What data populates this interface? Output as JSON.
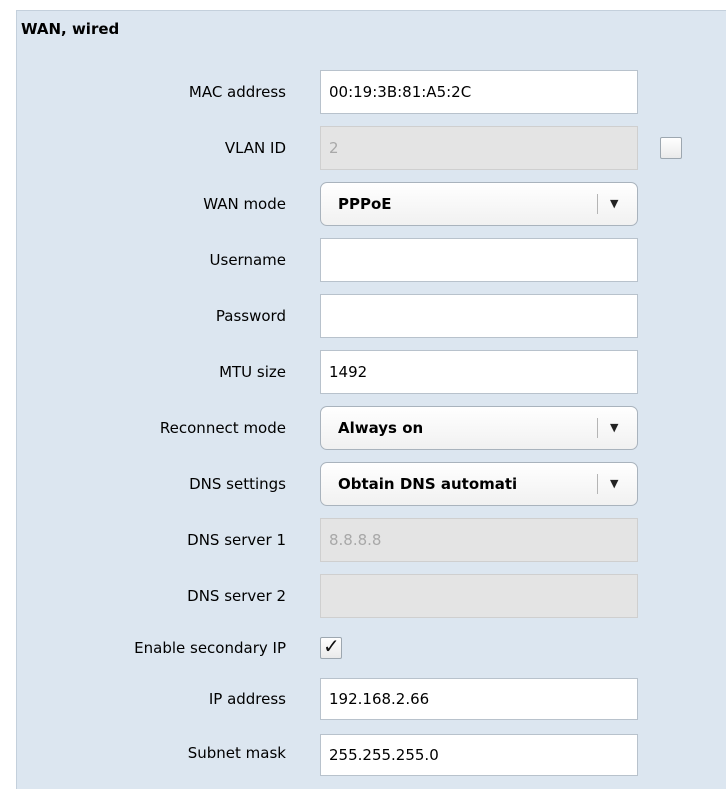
{
  "section": {
    "title": "WAN, wired"
  },
  "fields": {
    "mac_address": {
      "label": "MAC address",
      "value": "00:19:3B:81:A5:2C"
    },
    "vlan_id": {
      "label": "VLAN ID",
      "value": "2",
      "checkbox_checked": false
    },
    "wan_mode": {
      "label": "WAN mode",
      "selected": "PPPoE"
    },
    "username": {
      "label": "Username",
      "value": ""
    },
    "password": {
      "label": "Password",
      "value": ""
    },
    "mtu_size": {
      "label": "MTU size",
      "value": "1492"
    },
    "reconnect_mode": {
      "label": "Reconnect mode",
      "selected": "Always on"
    },
    "dns_settings": {
      "label": "DNS settings",
      "selected": "Obtain DNS automati"
    },
    "dns_server_1": {
      "label": "DNS server 1",
      "value": "8.8.8.8"
    },
    "dns_server_2": {
      "label": "DNS server 2",
      "value": ""
    },
    "enable_secondary_ip": {
      "label": "Enable secondary IP",
      "checked": true,
      "check_glyph": "✓"
    },
    "ip_address": {
      "label": "IP address",
      "value": "192.168.2.66"
    },
    "subnet_mask": {
      "label": "Subnet mask",
      "value": "255.255.255.0"
    }
  },
  "icons": {
    "dropdown_arrow": "▼"
  },
  "colors": {
    "panel_background": "#dce6f0",
    "disabled_input": "#e4e4e4",
    "disabled_text": "#a8a8a8"
  }
}
